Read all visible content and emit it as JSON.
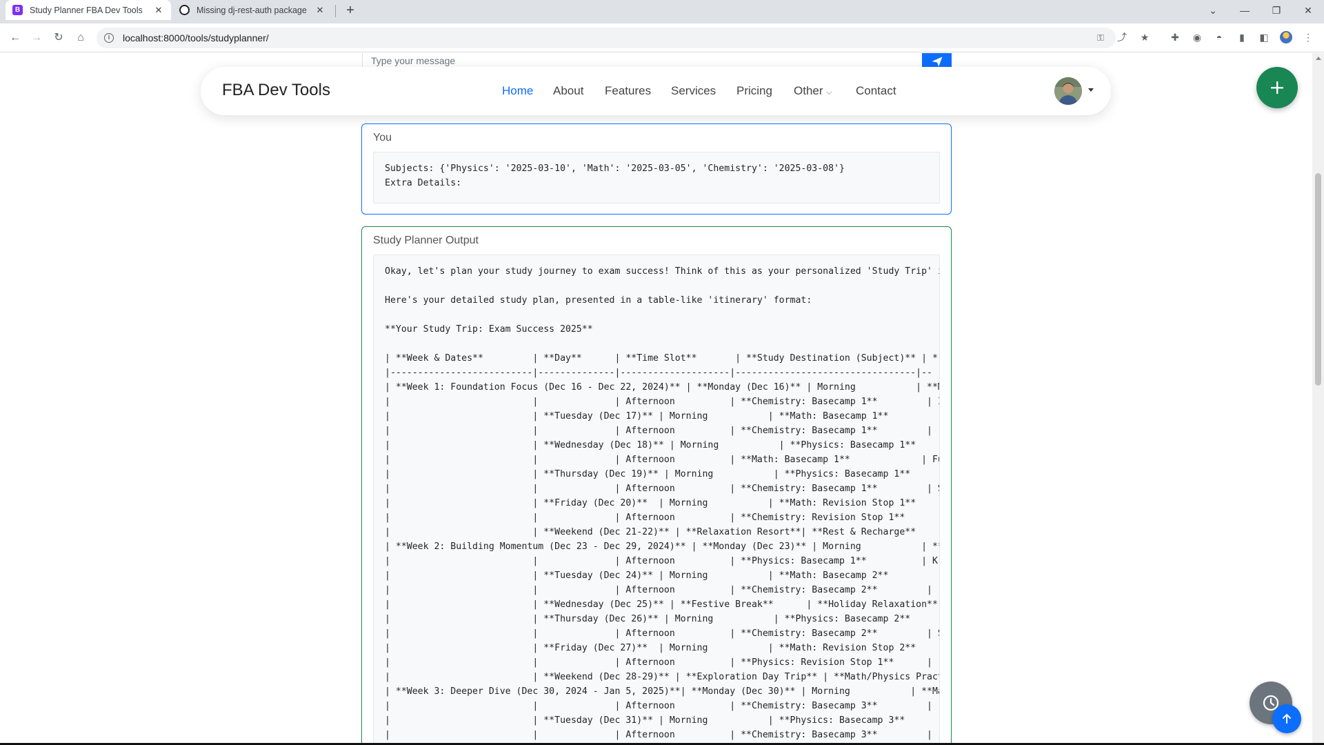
{
  "browser": {
    "tabs": [
      {
        "title": "Study Planner FBA Dev Tools",
        "favicon": "B",
        "favicon_color": "#7b2ff7",
        "active": true
      },
      {
        "title": "Missing dj-rest-auth package",
        "favicon": "openai-icon",
        "favicon_color": "#202124",
        "active": false
      }
    ],
    "url": "localhost:8000/tools/studyplanner/"
  },
  "chat": {
    "input_placeholder": "Type your message"
  },
  "navbar": {
    "brand": "FBA Dev Tools",
    "items": [
      {
        "label": "Home",
        "active": true
      },
      {
        "label": "About",
        "active": false
      },
      {
        "label": "Features",
        "active": false
      },
      {
        "label": "Services",
        "active": false
      },
      {
        "label": "Pricing",
        "active": false
      },
      {
        "label": "Other",
        "active": false,
        "dropdown": true
      },
      {
        "label": "Contact",
        "active": false
      }
    ]
  },
  "you_card": {
    "title": "You",
    "text": "Subjects: {'Physics': '2025-03-10', 'Math': '2025-03-05', 'Chemistry': '2025-03-08'}\nExtra Details:"
  },
  "output_card": {
    "title": "Study Planner Output",
    "text": "Okay, let's plan your study journey to exam success! Think of this as your personalized 'Study Trip' it\n\nHere's your detailed study plan, presented in a table-like 'itinerary' format:\n\n**Your Study Trip: Exam Success 2025**\n\n| **Week & Dates**         | **Day**      | **Time Slot**       | **Study Destination (Subject)** | *\n|--------------------------|--------------|--------------------|---------------------------------|--\n| **Week 1: Foundation Focus (Dec 16 - Dec 22, 2024)** | **Monday (Dec 16)** | Morning           | **M\n|                          |              | Afternoon          | **Chemistry: Basecamp 1**         | I\n|                          | **Tuesday (Dec 17)** | Morning           | **Math: Basecamp 1**\n|                          |              | Afternoon          | **Chemistry: Basecamp 1**         | (\n|                          | **Wednesday (Dec 18)** | Morning           | **Physics: Basecamp 1**\n|                          |              | Afternoon          | **Math: Basecamp 1**             | Fu\n|                          | **Thursday (Dec 19)** | Morning           | **Physics: Basecamp 1**\n|                          |              | Afternoon          | **Chemistry: Basecamp 1**         | S\n|                          | **Friday (Dec 20)**  | Morning           | **Math: Revision Stop 1**\n|                          |              | Afternoon          | **Chemistry: Revision Stop 1**      |\n|                          | **Weekend (Dec 21-22)** | **Relaxation Resort**| **Rest & Recharge**\n| **Week 2: Building Momentum (Dec 23 - Dec 29, 2024)** | **Monday (Dec 23)** | Morning           | **\n|                          |              | Afternoon          | **Physics: Basecamp 1**          | K:\n|                          | **Tuesday (Dec 24)** | Morning           | **Math: Basecamp 2**\n|                          |              | Afternoon          | **Chemistry: Basecamp 2**         | (\n|                          | **Wednesday (Dec 25)** | **Festive Break**      | **Holiday Relaxation**\n|                          | **Thursday (Dec 26)** | Morning           | **Physics: Basecamp 2**\n|                          |              | Afternoon          | **Chemistry: Basecamp 2**         | S\n|                          | **Friday (Dec 27)**  | Morning           | **Math: Revision Stop 2**\n|                          |              | Afternoon          | **Physics: Revision Stop 1**      |\n|                          | **Weekend (Dec 28-29)** | **Exploration Day Trip** | **Math/Physics Pract:\n| **Week 3: Deeper Dive (Dec 30, 2024 - Jan 5, 2025)**| **Monday (Dec 30)** | Morning           | **Ma\n|                          |              | Afternoon          | **Chemistry: Basecamp 3**         | (\n|                          | **Tuesday (Dec 31)** | Morning           | **Physics: Basecamp 3**\n|                          |              | Afternoon          | **Chemistry: Basecamp 3**         | ("
  },
  "colors": {
    "primary": "#0d6efd",
    "success": "#198754",
    "secondary": "#6c757d"
  }
}
